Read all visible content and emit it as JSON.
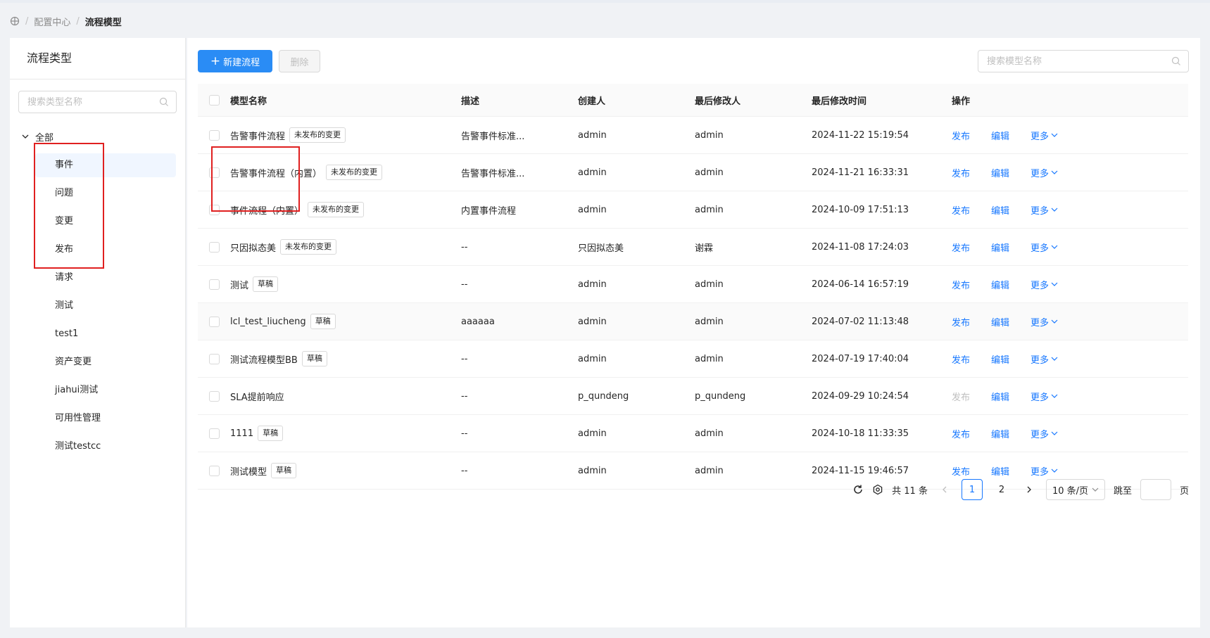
{
  "breadcrumb": {
    "items": [
      "配置中心",
      "流程模型"
    ]
  },
  "sidebar": {
    "title": "流程类型",
    "search_placeholder": "搜索类型名称",
    "root_label": "全部",
    "items": [
      "事件",
      "问题",
      "变更",
      "发布",
      "请求",
      "测试",
      "test1",
      "资产变更",
      "jiahui测试",
      "可用性管理",
      "测试testcc"
    ]
  },
  "toolbar": {
    "new_label": "新建流程",
    "delete_label": "删除",
    "search_placeholder": "搜索模型名称"
  },
  "table": {
    "columns": [
      "模型名称",
      "描述",
      "创建人",
      "最后修改人",
      "最后修改时间",
      "操作"
    ],
    "rows": [
      {
        "name": "告警事件流程",
        "tag": "未发布的变更",
        "desc": "告警事件标准...",
        "creator": "admin",
        "modifier": "admin",
        "time": "2024-11-22 15:19:54",
        "publish": "发布",
        "edit": "编辑",
        "more": "更多"
      },
      {
        "name": "告警事件流程（内置）",
        "tag": "未发布的变更",
        "desc": "告警事件标准...",
        "creator": "admin",
        "modifier": "admin",
        "time": "2024-11-21 16:33:31",
        "publish": "发布",
        "edit": "编辑",
        "more": "更多"
      },
      {
        "name": "事件流程（内置）",
        "tag": "未发布的变更",
        "desc": "内置事件流程",
        "creator": "admin",
        "modifier": "admin",
        "time": "2024-10-09 17:51:13",
        "publish": "发布",
        "edit": "编辑",
        "more": "更多"
      },
      {
        "name": "只因拟态美",
        "tag": "未发布的变更",
        "desc": "--",
        "creator": "只因拟态美",
        "modifier": "谢霖",
        "time": "2024-11-08 17:24:03",
        "publish": "发布",
        "edit": "编辑",
        "more": "更多"
      },
      {
        "name": "测试",
        "tag": "草稿",
        "desc": "--",
        "creator": "admin",
        "modifier": "admin",
        "time": "2024-06-14 16:57:19",
        "publish": "发布",
        "edit": "编辑",
        "more": "更多"
      },
      {
        "name": "lcl_test_liucheng",
        "tag": "草稿",
        "desc": "aaaaaa",
        "creator": "admin",
        "modifier": "admin",
        "time": "2024-07-02 11:13:48",
        "publish": "发布",
        "edit": "编辑",
        "more": "更多"
      },
      {
        "name": "测试流程模型BB",
        "tag": "草稿",
        "desc": "--",
        "creator": "admin",
        "modifier": "admin",
        "time": "2024-07-19 17:40:04",
        "publish": "发布",
        "edit": "编辑",
        "more": "更多"
      },
      {
        "name": "SLA提前响应",
        "tag": "",
        "desc": "--",
        "creator": "p_qundeng",
        "modifier": "p_qundeng",
        "time": "2024-09-29 10:24:54",
        "publish": "发布",
        "edit": "编辑",
        "more": "更多"
      },
      {
        "name": "1111",
        "tag": "草稿",
        "desc": "--",
        "creator": "admin",
        "modifier": "admin",
        "time": "2024-10-18 11:33:35",
        "publish": "发布",
        "edit": "编辑",
        "more": "更多"
      },
      {
        "name": "测试模型",
        "tag": "草稿",
        "desc": "--",
        "creator": "admin",
        "modifier": "admin",
        "time": "2024-11-15 19:46:57",
        "publish": "发布",
        "edit": "编辑",
        "more": "更多"
      }
    ]
  },
  "pagination": {
    "total_label": "共 11 条",
    "pages": [
      "1",
      "2"
    ],
    "current_page": "1",
    "page_size_label": "10 条/页",
    "jump_label": "跳至",
    "page_suffix": "页"
  },
  "colors": {
    "accent": "#2a8cf5",
    "link": "#1677ff",
    "annotation": "#e02020"
  }
}
